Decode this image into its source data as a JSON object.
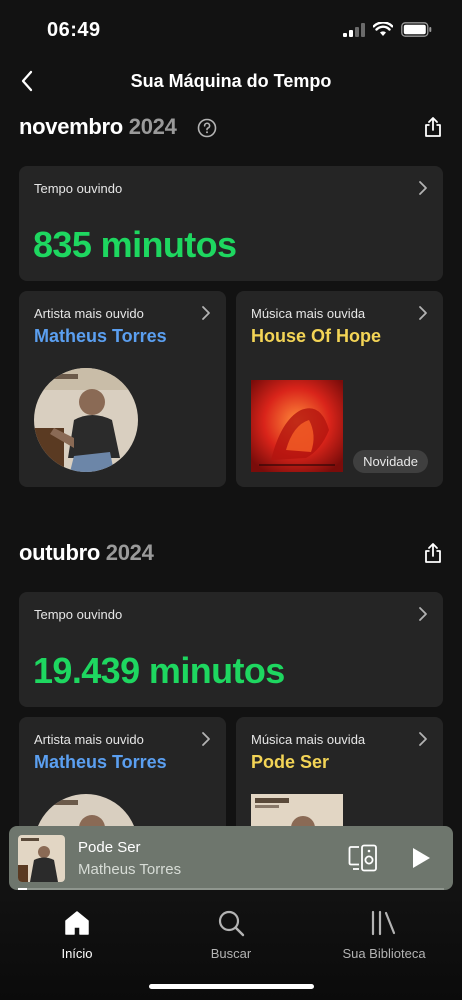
{
  "status_bar": {
    "time": "06:49"
  },
  "header": {
    "title": "Sua Máquina do Tempo"
  },
  "sections": [
    {
      "month": "novembro",
      "year": "2024",
      "time_card": {
        "label": "Tempo ouvindo",
        "value": "835 minutos"
      },
      "artist_card": {
        "label": "Artista mais ouvido",
        "name": "Matheus Torres"
      },
      "song_card": {
        "label": "Música mais ouvida",
        "name": "House Of Hope",
        "badge": "Novidade"
      }
    },
    {
      "month": "outubro",
      "year": "2024",
      "time_card": {
        "label": "Tempo ouvindo",
        "value": "19.439 minutos"
      },
      "artist_card": {
        "label": "Artista mais ouvido",
        "name": "Matheus Torres"
      },
      "song_card": {
        "label": "Música mais ouvida",
        "name": "Pode Ser"
      }
    }
  ],
  "player": {
    "title": "Pode Ser",
    "artist": "Matheus Torres",
    "progress": 0.02
  },
  "tabs": [
    {
      "label": "Início",
      "icon": "home-icon",
      "active": true
    },
    {
      "label": "Buscar",
      "icon": "search-icon",
      "active": false
    },
    {
      "label": "Sua Biblioteca",
      "icon": "library-icon",
      "active": false
    }
  ],
  "colors": {
    "background": "#121212",
    "card": "#252525",
    "accent_green": "#1ed760",
    "artist_blue": "#5b9ff0",
    "song_yellow": "#f3d456",
    "player_bg": "#6e766d"
  }
}
